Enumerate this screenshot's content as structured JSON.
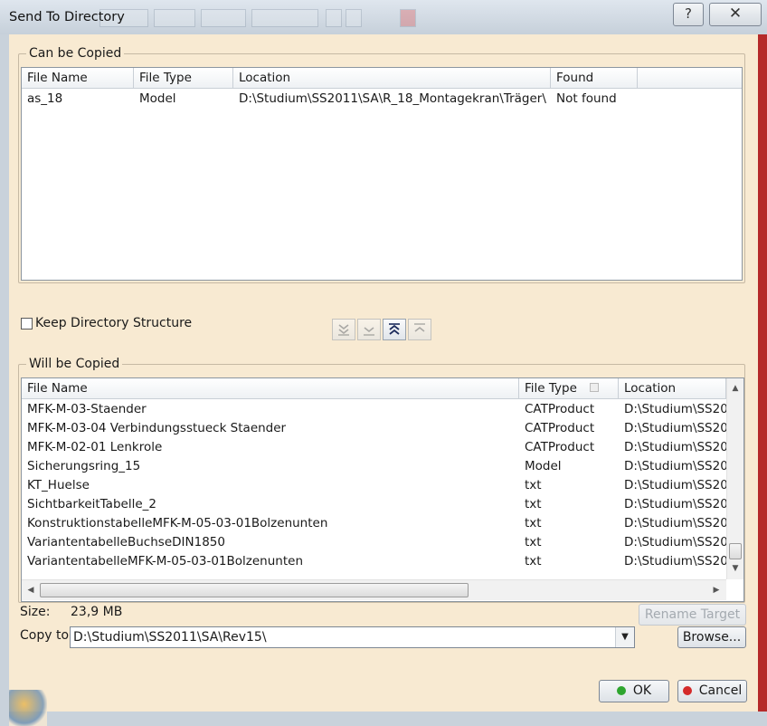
{
  "window": {
    "title": "Send To Directory",
    "help_glyph": "?",
    "close_glyph": "✕"
  },
  "can_copy": {
    "legend": "Can be Copied",
    "columns": [
      "File Name",
      "File Type",
      "Location",
      "Found"
    ],
    "rows": [
      {
        "name": "as_18",
        "type": "Model",
        "location": "D:\\Studium\\SS2011\\SA\\R_18_Montagekran\\Träger\\",
        "found": "Not found"
      }
    ]
  },
  "move_buttons": [
    {
      "name": "move-all-down-button",
      "icon": "double-chevron-down-icon",
      "enabled": true
    },
    {
      "name": "move-down-button",
      "icon": "chevron-down-icon",
      "enabled": true
    },
    {
      "name": "move-all-up-button",
      "icon": "double-chevron-up-icon",
      "enabled": true
    },
    {
      "name": "move-up-button",
      "icon": "chevron-up-icon",
      "enabled": true
    }
  ],
  "keep_structure": {
    "label": "Keep Directory Structure",
    "checked": false
  },
  "will_copy": {
    "legend": "Will be Copied",
    "columns": [
      "File Name",
      "File Type",
      "Location"
    ],
    "rows": [
      {
        "name": "MFK-M-03-Staender",
        "type": "CATProduct",
        "location": "D:\\Studium\\SS20"
      },
      {
        "name": "MFK-M-03-04 Verbindungsstueck Staender",
        "type": "CATProduct",
        "location": "D:\\Studium\\SS20"
      },
      {
        "name": "MFK-M-02-01 Lenkrole",
        "type": "CATProduct",
        "location": "D:\\Studium\\SS20"
      },
      {
        "name": "Sicherungsring_15",
        "type": "Model",
        "location": "D:\\Studium\\SS20"
      },
      {
        "name": "KT_Huelse",
        "type": "txt",
        "location": "D:\\Studium\\SS20"
      },
      {
        "name": "SichtbarkeitTabelle_2",
        "type": "txt",
        "location": "D:\\Studium\\SS20"
      },
      {
        "name": "KonstruktionstabelleMFK-M-05-03-01Bolzenunten",
        "type": "txt",
        "location": "D:\\Studium\\SS20"
      },
      {
        "name": "VariantentabelleBuchseDIN1850",
        "type": "txt",
        "location": "D:\\Studium\\SS20"
      },
      {
        "name": "VariantentabelleMFK-M-05-03-01Bolzenunten",
        "type": "txt",
        "location": "D:\\Studium\\SS20"
      }
    ]
  },
  "size": {
    "label": "Size:",
    "value": "23,9 MB"
  },
  "rename_target": {
    "label": "Rename Target",
    "enabled": false
  },
  "copy_to": {
    "label": "Copy to:",
    "value": "D:\\Studium\\SS2011\\SA\\Rev15\\"
  },
  "browse": {
    "label": "Browse..."
  },
  "ok": {
    "label": "OK"
  },
  "cancel": {
    "label": "Cancel"
  },
  "colors": {
    "dialog_bg": "#f8ead2",
    "ok_dot": "#2ea52e",
    "cancel_dot": "#d42a2a"
  }
}
